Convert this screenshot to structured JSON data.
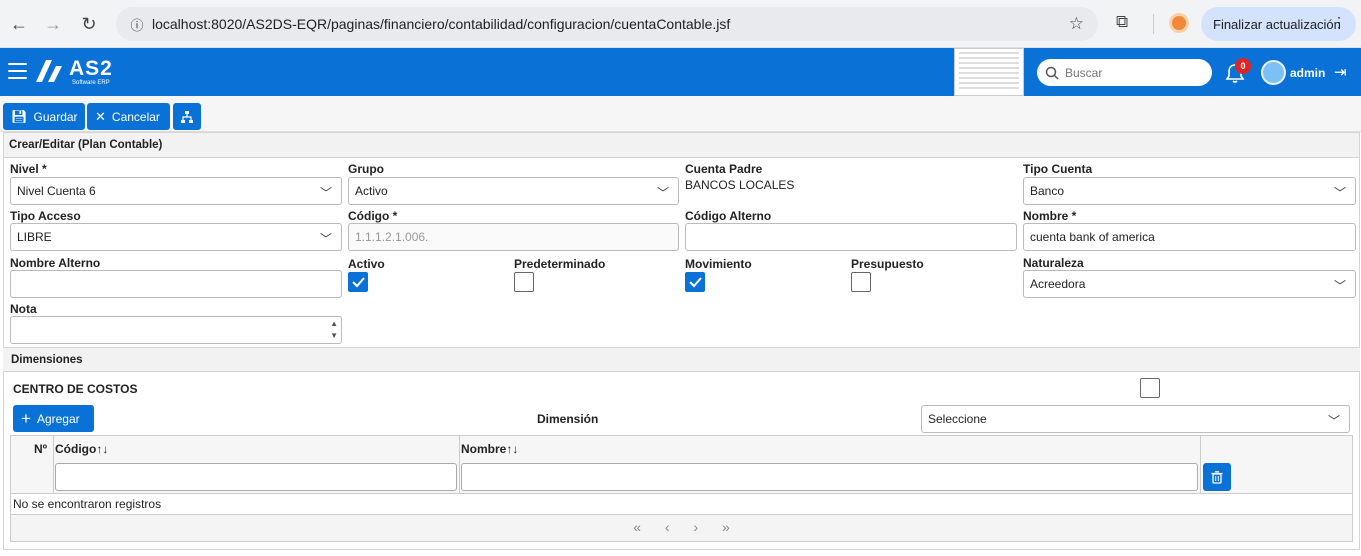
{
  "browser": {
    "url": "localhost:8020/AS2DS-EQR/paginas/financiero/contabilidad/configuracion/cuentaContable.jsf",
    "update_label": "Finalizar actualización"
  },
  "app": {
    "logo_text": "AS2",
    "logo_sub": "Software ERP",
    "search_placeholder": "Buscar",
    "notifications_count": "0",
    "user": "admin"
  },
  "toolbar": {
    "save_label": "Guardar",
    "cancel_label": "Cancelar"
  },
  "panel": {
    "title": "Crear/Editar (Plan Contable)"
  },
  "form": {
    "nivel": {
      "label": "Nivel *",
      "value": "Nivel Cuenta 6"
    },
    "grupo": {
      "label": "Grupo",
      "value": "Activo"
    },
    "cuenta_padre": {
      "label": "Cuenta Padre",
      "value": "BANCOS LOCALES"
    },
    "tipo_cuenta": {
      "label": "Tipo Cuenta",
      "value": "Banco"
    },
    "tipo_acceso": {
      "label": "Tipo Acceso",
      "value": "LIBRE"
    },
    "codigo": {
      "label": "Código *",
      "value": "1.1.1.2.1.006."
    },
    "codigo_alterno": {
      "label": "Código Alterno",
      "value": ""
    },
    "nombre": {
      "label": "Nombre *",
      "value": "cuenta bank of america"
    },
    "nombre_alterno": {
      "label": "Nombre Alterno",
      "value": ""
    },
    "activo": {
      "label": "Activo",
      "checked": true
    },
    "predeterminado": {
      "label": "Predeterminado",
      "checked": false
    },
    "movimiento": {
      "label": "Movimiento",
      "checked": true
    },
    "presupuesto": {
      "label": "Presupuesto",
      "checked": false
    },
    "naturaleza": {
      "label": "Naturaleza",
      "value": "Acreedora"
    },
    "nota": {
      "label": "Nota",
      "value": ""
    }
  },
  "dimensiones": {
    "title": "Dimensiones",
    "centro_costos_label": "CENTRO DE COSTOS",
    "add_label": "Agregar",
    "dimension_label": "Dimensión",
    "dimension_value": "Seleccione",
    "table": {
      "col_no": "Nº",
      "col_codigo": "Código",
      "col_nombre": "Nombre",
      "empty_message": "No se encontraron registros"
    }
  }
}
